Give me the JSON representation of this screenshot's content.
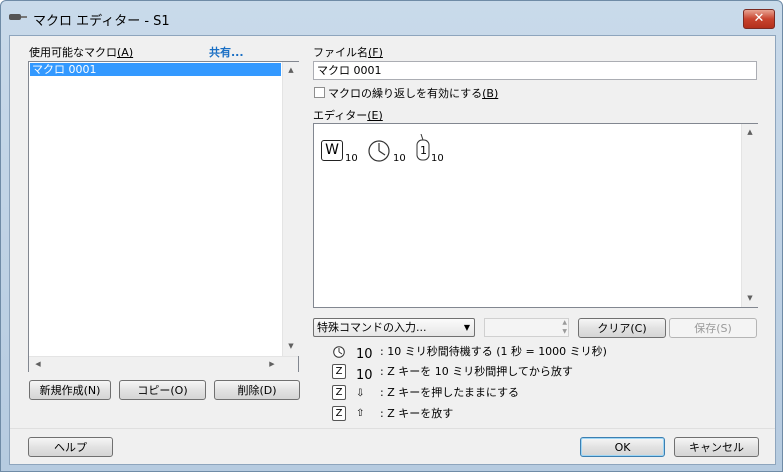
{
  "window": {
    "title": "マクロ エディター - S1",
    "close_label": "✕"
  },
  "macros_panel": {
    "label": "使用可能なマクロ",
    "label_key": "(A)",
    "share_link": "共有...",
    "items": [
      "マクロ 0001"
    ],
    "new_button": "新規作成(N)",
    "copy_button": "コピー(O)",
    "delete_button": "削除(D)"
  },
  "file": {
    "label": "ファイル名",
    "label_key": "(F)",
    "value": "マクロ 0001",
    "repeat_label": "マクロの繰り返しを有効にする",
    "repeat_key": "(B)",
    "repeat_checked": false
  },
  "editor": {
    "label": "エディター",
    "label_key": "(E)",
    "tokens": [
      {
        "icon": "W",
        "value": "10"
      },
      {
        "icon": "clock",
        "value": "10"
      },
      {
        "icon": "1",
        "value": "10"
      }
    ]
  },
  "controls": {
    "special_command": "特殊コマンドの入力...",
    "stepper_value": "",
    "clear_button": "クリア(C)",
    "save_button": "保存(S)"
  },
  "legend": [
    {
      "icon": "clock",
      "count": "10",
      "text": ": 10 ミリ秒間待機する (1 秒 = 1000 ミリ秒)"
    },
    {
      "icon": "Z",
      "count": "10",
      "text": ": Z キーを 10 ミリ秒間押してから放す"
    },
    {
      "icon": "Z",
      "count": "⇩",
      "text": ": Z キーを押したままにする"
    },
    {
      "icon": "Z",
      "count": "⇧",
      "text": ": Z キーを放す"
    }
  ],
  "footer": {
    "help_button": "ヘルプ",
    "ok_button": "OK",
    "cancel_button": "キャンセル"
  }
}
